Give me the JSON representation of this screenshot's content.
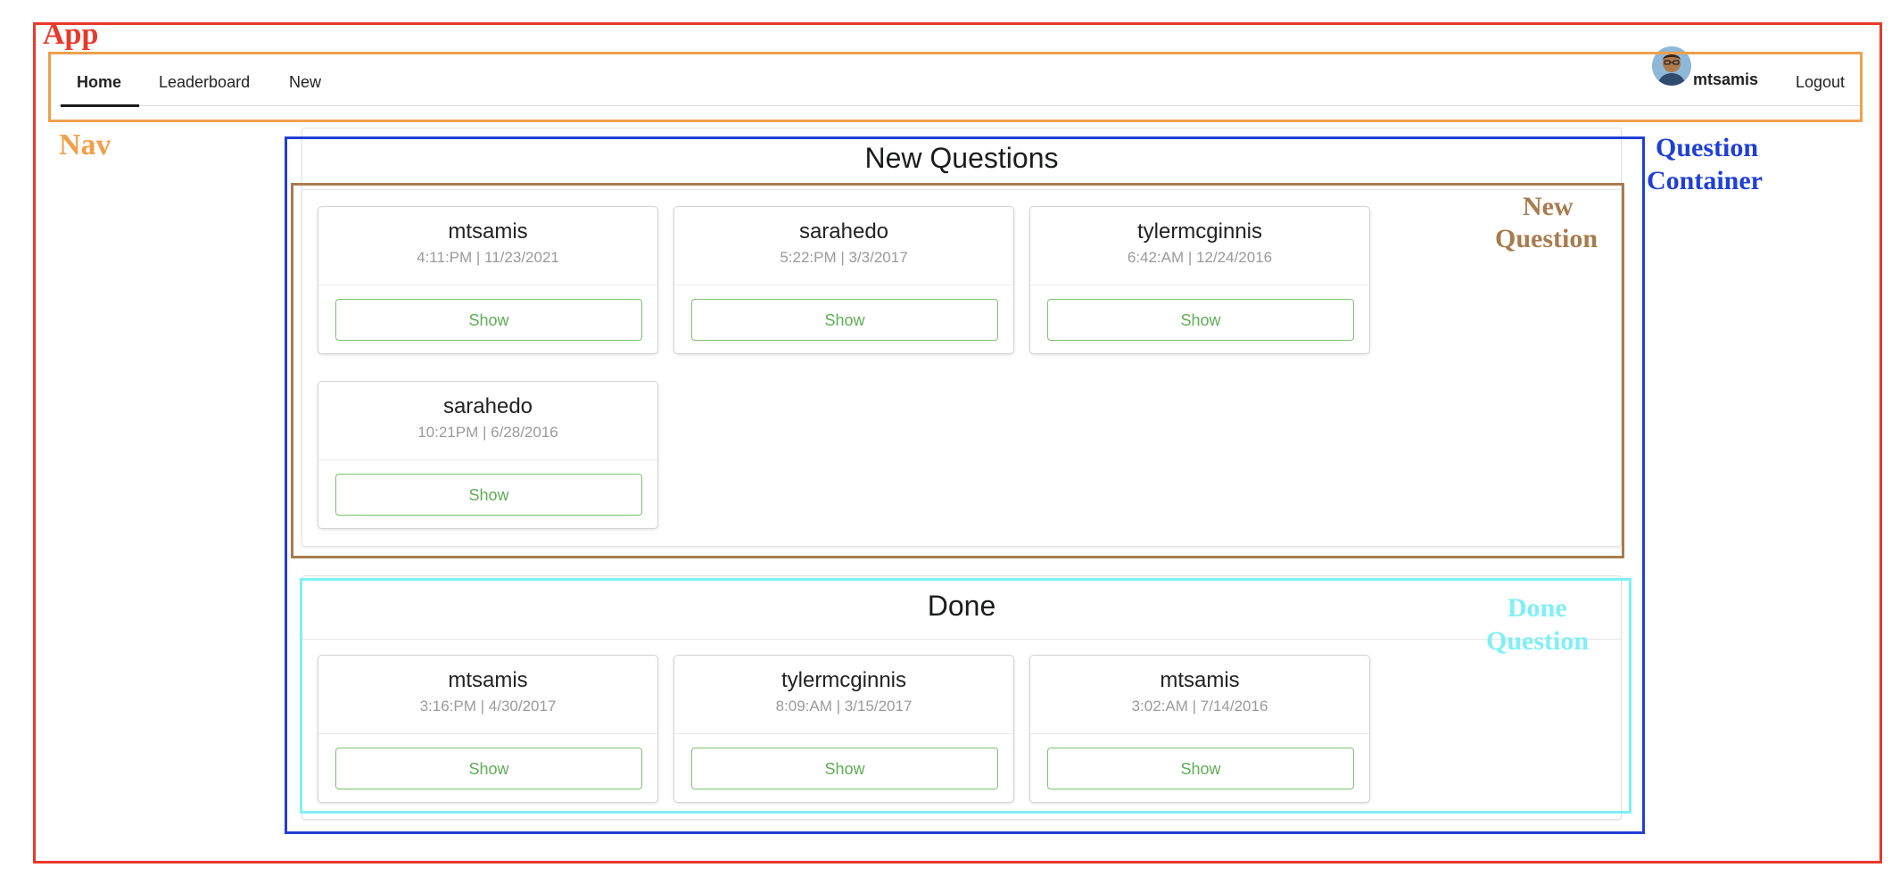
{
  "annotations": {
    "app": "App",
    "nav": "Nav",
    "question_container": [
      "Question",
      "Container"
    ],
    "new_question": [
      "New",
      "Question"
    ],
    "done_question": [
      "Done",
      "Question"
    ]
  },
  "nav": {
    "items": [
      {
        "label": "Home",
        "active": true
      },
      {
        "label": "Leaderboard",
        "active": false
      },
      {
        "label": "New",
        "active": false
      }
    ],
    "user": {
      "name": "mtsamis"
    },
    "logout_label": "Logout"
  },
  "new_questions": {
    "title": "New Questions",
    "cards": [
      {
        "author": "mtsamis",
        "time": "4:11:PM | 11/23/2021",
        "button": "Show"
      },
      {
        "author": "sarahedo",
        "time": "5:22:PM | 3/3/2017",
        "button": "Show"
      },
      {
        "author": "tylermcginnis",
        "time": "6:42:AM | 12/24/2016",
        "button": "Show"
      },
      {
        "author": "sarahedo",
        "time": "10:21PM | 6/28/2016",
        "button": "Show"
      }
    ]
  },
  "done": {
    "title": "Done",
    "cards": [
      {
        "author": "mtsamis",
        "time": "3:16:PM | 4/30/2017",
        "button": "Show"
      },
      {
        "author": "tylermcginnis",
        "time": "8:09:AM | 3/15/2017",
        "button": "Show"
      },
      {
        "author": "mtsamis",
        "time": "3:02:AM | 7/14/2016",
        "button": "Show"
      }
    ]
  },
  "colors": {
    "app": "#e8392a",
    "nav": "#f0a04b",
    "question_container": "#1f3fd6",
    "new_question": "#a87c4f",
    "done_question": "#7ff0f4",
    "button": "#7cc36f"
  }
}
